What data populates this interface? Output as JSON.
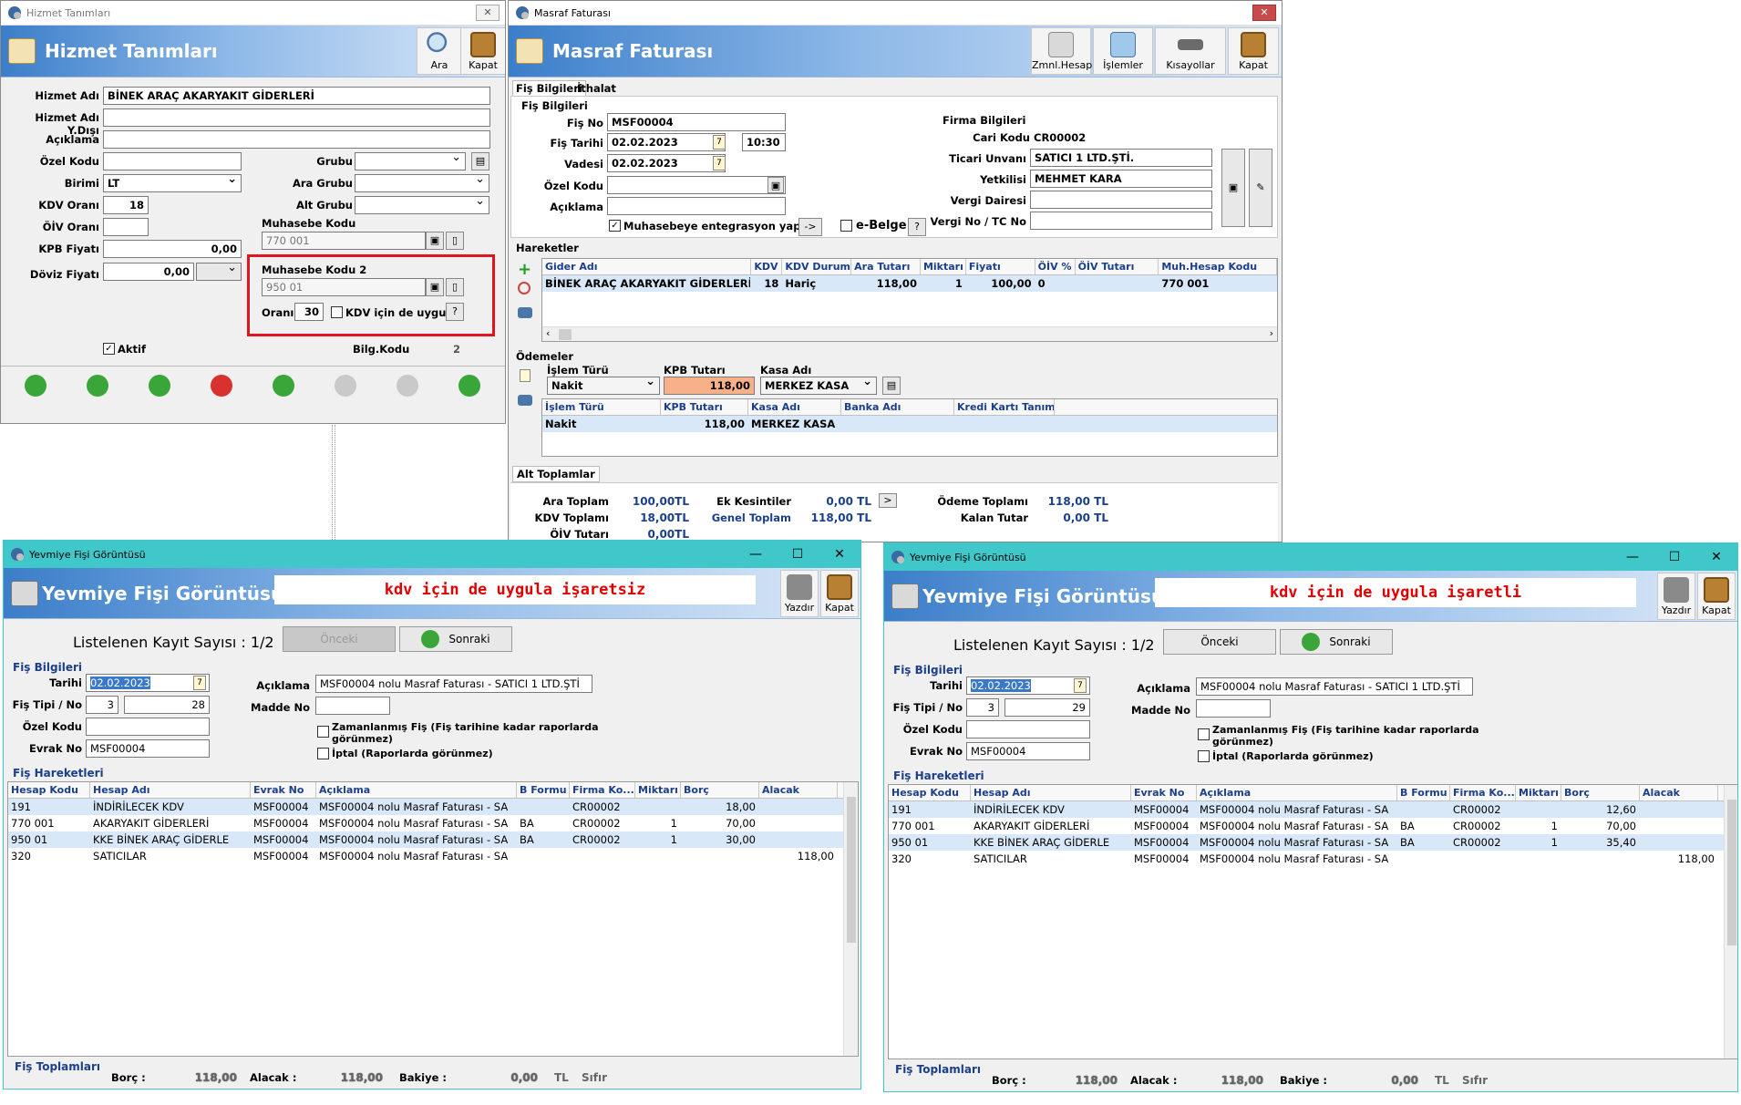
{
  "hizmet": {
    "window_title": "Hizmet Tanımları",
    "header_title": "Hizmet Tanımları",
    "close_glyph": "✕",
    "tools": [
      {
        "label": "Ara"
      },
      {
        "label": "Kapat"
      }
    ],
    "fields": {
      "hizmet_adi": {
        "label": "Hizmet Adı",
        "value": "BİNEK ARAÇ AKARYAKIT GİDERLERİ"
      },
      "hizmet_adi_yd": {
        "label": "Hizmet Adı Y.Dışı",
        "value": ""
      },
      "aciklama": {
        "label": "Açıklama",
        "value": ""
      },
      "ozel_kodu": {
        "label": "Özel Kodu",
        "value": ""
      },
      "birimi": {
        "label": "Birimi",
        "value": "LT"
      },
      "kdv_orani": {
        "label": "KDV Oranı",
        "value": "18"
      },
      "oiv_orani": {
        "label": "ÖİV Oranı",
        "value": ""
      },
      "kpb_fiyati": {
        "label": "KPB Fiyatı",
        "value": "0,00"
      },
      "doviz_fiyati": {
        "label": "Döviz Fiyatı",
        "value": "0,00"
      },
      "grubu": {
        "label": "Grubu",
        "value": ""
      },
      "ara_grubu": {
        "label": "Ara Grubu",
        "value": ""
      },
      "alt_grubu": {
        "label": "Alt Grubu",
        "value": ""
      },
      "muhasebe_kodu": {
        "label": "Muhasebe Kodu",
        "value": "770 001"
      },
      "muhasebe_kodu2": {
        "label": "Muhasebe Kodu 2",
        "value": "950 01"
      },
      "orani": {
        "label": "Oranı",
        "value": "30"
      },
      "kdv_uygula": {
        "label": "KDV için de uygula",
        "checked": false
      },
      "help": "?",
      "aktif": {
        "label": "Aktif",
        "checked": true
      },
      "bilg_kodu": {
        "label": "Bilg.Kodu",
        "value": "2"
      }
    },
    "highlight_color": "#e0141e"
  },
  "masraf": {
    "window_title": "Masraf Faturası",
    "header_title": "Masraf Faturası",
    "close_glyph": "✕",
    "tools": [
      {
        "label": "Zmnl.Hesap"
      },
      {
        "label": "İşlemler"
      },
      {
        "label": "Kısayollar"
      },
      {
        "label": "Kapat"
      }
    ],
    "tabs": [
      {
        "label": "Fiş Bilgileri"
      },
      {
        "label": "İthalat"
      }
    ],
    "fis_section": "Fiş Bilgileri",
    "fis_no": {
      "label": "Fiş No",
      "value": "MSF00004"
    },
    "fis_tarihi": {
      "label": "Fiş Tarihi",
      "value": "02.02.2023",
      "time": "10:30"
    },
    "vadesi": {
      "label": "Vadesi",
      "value": "02.02.2023"
    },
    "ozel_kodu": {
      "label": "Özel Kodu",
      "value": ""
    },
    "aciklama": {
      "label": "Açıklama",
      "value": ""
    },
    "muh_entegrasyon": {
      "label": "Muhasebeye entegrasyon yap",
      "checked": true
    },
    "arrow_btn": "->",
    "ebelge": {
      "label": "e-Belge",
      "checked": false
    },
    "help": "?",
    "firma_section": "Firma Bilgileri",
    "cari_kodu": {
      "label": "Cari Kodu",
      "value": "CR00002"
    },
    "ticari_unvani": {
      "label": "Ticari Unvanı",
      "value": "SATICI 1 LTD.ŞTİ."
    },
    "yetkilisi": {
      "label": "Yetkilisi",
      "value": "MEHMET KARA"
    },
    "vergi_dairesi": {
      "label": "Vergi Dairesi",
      "value": ""
    },
    "vergi_no": {
      "label": "Vergi No / TC No",
      "value": ""
    },
    "hareketler_section": "Hareketler",
    "hareketler_columns": [
      "Gider Adı",
      "KDV",
      "KDV Durumu",
      "Ara Tutarı",
      "Miktarı",
      "Fiyatı",
      "ÖİV %",
      "ÖİV Tutarı",
      "Muh.Hesap Kodu"
    ],
    "hareketler_rows": [
      [
        "BİNEK ARAÇ AKARYAKIT GİDERLERİ",
        "18",
        "Hariç",
        "118,00",
        "1",
        "100,00",
        "0",
        "",
        "770 001"
      ]
    ],
    "odemeler_section": "Ödemeler",
    "odeme_form": {
      "islem_turu_label": "İşlem Türü",
      "islem_turu": "Nakit",
      "kpb_label": "KPB Tutarı",
      "kpb": "118,00",
      "kasa_label": "Kasa Adı",
      "kasa": "MERKEZ KASA"
    },
    "odeme_columns": [
      "İşlem Türü",
      "KPB Tutarı",
      "Kasa Adı",
      "Banka Adı",
      "Kredi Kartı Tanımı"
    ],
    "odeme_rows": [
      [
        "Nakit",
        "118,00",
        "MERKEZ KASA",
        "",
        ""
      ]
    ],
    "alt_toplamlar_tab": "Alt Toplamlar",
    "totals": {
      "ara_toplam": {
        "label": "Ara Toplam",
        "value": "100,00TL"
      },
      "kdv_toplami": {
        "label": "KDV Toplamı",
        "value": "18,00TL"
      },
      "oiv_tutari": {
        "label": "ÖİV Tutarı",
        "value": "0,00TL"
      },
      "ek_kesintiler": {
        "label": "Ek Kesintiler",
        "value": "0,00 TL"
      },
      "genel_toplam": {
        "label": "Genel Toplam",
        "value": "118,00 TL"
      },
      "odeme_toplami": {
        "label": "Ödeme Toplamı",
        "value": "118,00 TL"
      },
      "kalan_tutar": {
        "label": "Kalan Tutar",
        "value": "0,00 TL"
      },
      "more_btn": ">"
    }
  },
  "yevmiye_left": {
    "window_title": "Yevmiye Fişi Görüntüsü",
    "header_title": "Yevmiye Fişi Görüntüsü",
    "note": "kdv için de uygula işaretsiz",
    "tools": [
      {
        "label": "Yazdır"
      },
      {
        "label": "Kapat"
      }
    ],
    "win_btns": [
      "—",
      "☐",
      "✕"
    ],
    "kayit": "Listelenen Kayıt Sayısı : 1/2",
    "onceki": "Önceki",
    "sonraki": "Sonraki",
    "fis_section": "Fiş Bilgileri",
    "tarihi": {
      "label": "Tarihi",
      "value": "02.02.2023"
    },
    "fis_tipi": {
      "label": "Fiş Tipi / No",
      "tip": "3",
      "no": "28"
    },
    "ozel_kodu": {
      "label": "Özel Kodu",
      "value": ""
    },
    "evrak_no": {
      "label": "Evrak No",
      "value": "MSF00004"
    },
    "aciklama": {
      "label": "Açıklama",
      "value": "MSF00004 nolu Masraf Faturası - SATICI 1 LTD.ŞTİ"
    },
    "madde_no": {
      "label": "Madde No",
      "value": ""
    },
    "zamanlanmis": {
      "label": "Zamanlanmış Fiş (Fiş tarihine kadar raporlarda",
      "label2": "görünmez)"
    },
    "iptal": {
      "label": "İptal (Raporlarda görünmez)"
    },
    "hareket_section": "Fiş Hareketleri",
    "columns": [
      "Hesap Kodu",
      "Hesap Adı",
      "Evrak No",
      "Açıklama",
      "B Formu",
      "Firma Ko...",
      "Miktarı",
      "Borç",
      "Alacak"
    ],
    "rows": [
      [
        "191",
        "İNDİRİLECEK KDV",
        "MSF00004",
        "MSF00004 nolu Masraf Faturası - SA",
        "",
        "CR00002",
        "",
        "18,00",
        ""
      ],
      [
        "770 001",
        "AKARYAKIT GİDERLERİ",
        "MSF00004",
        "MSF00004 nolu Masraf Faturası - SA",
        "BA",
        "CR00002",
        "1",
        "70,00",
        ""
      ],
      [
        "950 01",
        "KKE BİNEK ARAÇ GİDERLE",
        "MSF00004",
        "MSF00004 nolu Masraf Faturası - SA",
        "BA",
        "CR00002",
        "1",
        "30,00",
        ""
      ],
      [
        "320",
        "SATICILAR",
        "MSF00004",
        "MSF00004 nolu Masraf Faturası - SA",
        "",
        "",
        "",
        "",
        "118,00"
      ]
    ],
    "toplam_section": "Fiş Toplamları",
    "borc": {
      "label": "Borç :",
      "value": "118,00"
    },
    "alacak": {
      "label": "Alacak :",
      "value": "118,00"
    },
    "bakiye": {
      "label": "Bakiye :",
      "value": "0,00"
    },
    "tl": "TL",
    "sifir": "Sıfır"
  },
  "yevmiye_right": {
    "window_title": "Yevmiye Fişi Görüntüsü",
    "header_title": "Yevmiye Fişi Görüntüsü",
    "note": "kdv için de uygula işaretli",
    "tools": [
      {
        "label": "Yazdır"
      },
      {
        "label": "Kapat"
      }
    ],
    "win_btns": [
      "—",
      "☐",
      "✕"
    ],
    "kayit": "Listelenen Kayıt Sayısı : 1/2",
    "onceki": "Önceki",
    "sonraki": "Sonraki",
    "fis_section": "Fiş Bilgileri",
    "tarihi": {
      "label": "Tarihi",
      "value": "02.02.2023"
    },
    "fis_tipi": {
      "label": "Fiş Tipi / No",
      "tip": "3",
      "no": "29"
    },
    "ozel_kodu": {
      "label": "Özel Kodu",
      "value": ""
    },
    "evrak_no": {
      "label": "Evrak No",
      "value": "MSF00004"
    },
    "aciklama": {
      "label": "Açıklama",
      "value": "MSF00004 nolu Masraf Faturası - SATICI 1 LTD.ŞTİ"
    },
    "madde_no": {
      "label": "Madde No",
      "value": ""
    },
    "zamanlanmis": {
      "label": "Zamanlanmış Fiş (Fiş tarihine kadar raporlarda",
      "label2": "görünmez)"
    },
    "iptal": {
      "label": "İptal (Raporlarda görünmez)"
    },
    "hareket_section": "Fiş Hareketleri",
    "columns": [
      "Hesap Kodu",
      "Hesap Adı",
      "Evrak No",
      "Açıklama",
      "B Formu",
      "Firma Ko...",
      "Miktarı",
      "Borç",
      "Alacak"
    ],
    "rows": [
      [
        "191",
        "İNDİRİLECEK KDV",
        "MSF00004",
        "MSF00004 nolu Masraf Faturası - SA",
        "",
        "CR00002",
        "",
        "12,60",
        ""
      ],
      [
        "770 001",
        "AKARYAKIT GİDERLERİ",
        "MSF00004",
        "MSF00004 nolu Masraf Faturası - SA",
        "BA",
        "CR00002",
        "1",
        "70,00",
        ""
      ],
      [
        "950 01",
        "KKE BİNEK ARAÇ GİDERLE",
        "MSF00004",
        "MSF00004 nolu Masraf Faturası - SA",
        "BA",
        "CR00002",
        "1",
        "35,40",
        ""
      ],
      [
        "320",
        "SATICILAR",
        "MSF00004",
        "MSF00004 nolu Masraf Faturası - SA",
        "",
        "",
        "",
        "",
        "118,00"
      ]
    ],
    "toplam_section": "Fiş Toplamları",
    "borc": {
      "label": "Borç :",
      "value": "118,00"
    },
    "alacak": {
      "label": "Alacak :",
      "value": "118,00"
    },
    "bakiye": {
      "label": "Bakiye :",
      "value": "0,00"
    },
    "tl": "TL",
    "sifir": "Sıfır"
  }
}
